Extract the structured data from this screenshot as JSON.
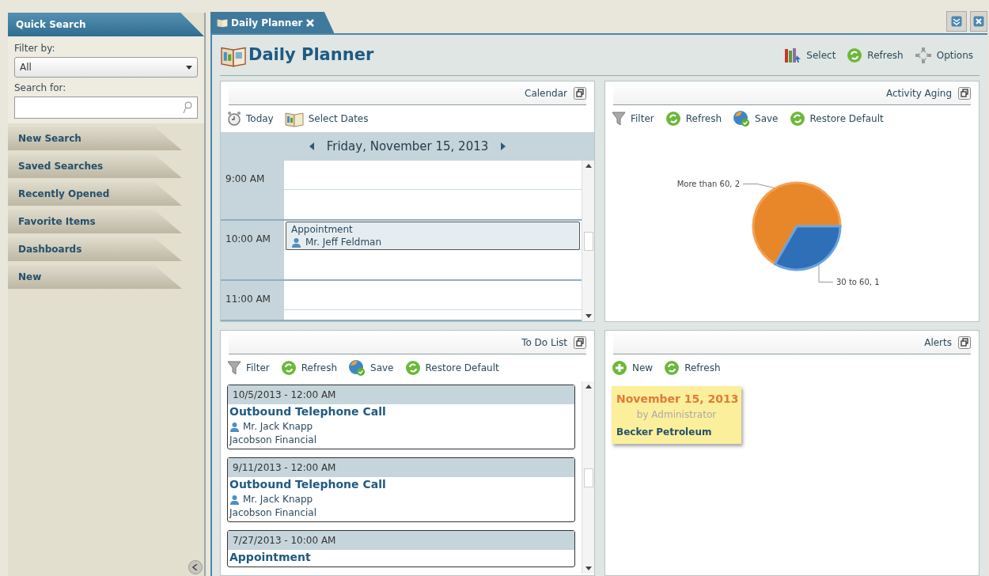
{
  "sidebar": {
    "title": "Quick Search",
    "filter_label": "Filter by:",
    "filter_value": "All",
    "search_label": "Search for:",
    "sections": [
      "New Search",
      "Saved Searches",
      "Recently Opened",
      "Favorite Items",
      "Dashboards",
      "New"
    ]
  },
  "tab": {
    "label": "Daily Planner"
  },
  "header": {
    "title": "Daily Planner",
    "actions": [
      {
        "kind": "select",
        "label": "Select"
      },
      {
        "kind": "refresh",
        "label": "Refresh"
      },
      {
        "kind": "options",
        "label": "Options"
      }
    ]
  },
  "calendar": {
    "title": "Calendar",
    "actions": [
      {
        "kind": "today",
        "label": "Today"
      },
      {
        "kind": "dates",
        "label": "Select Dates"
      }
    ],
    "date": "Friday, November 15, 2013",
    "hours": [
      {
        "time": "9:00 AM"
      },
      {
        "time": "10:00 AM",
        "appointment": {
          "title": "Appointment",
          "person": "Mr. Jeff Feldman"
        }
      },
      {
        "time": "11:00 AM"
      }
    ]
  },
  "activity_aging": {
    "title": "Activity Aging",
    "actions": [
      {
        "kind": "filter",
        "label": "Filter"
      },
      {
        "kind": "refresh",
        "label": "Refresh"
      },
      {
        "kind": "save",
        "label": "Save"
      },
      {
        "kind": "restore",
        "label": "Restore Default"
      }
    ],
    "chart_data": {
      "type": "pie",
      "values": [
        2,
        1
      ],
      "value_labels": [
        "More than 60, 2",
        "30 to 60, 1"
      ]
    }
  },
  "todo": {
    "title": "To Do List",
    "actions": [
      {
        "kind": "filter",
        "label": "Filter"
      },
      {
        "kind": "refresh",
        "label": "Refresh"
      },
      {
        "kind": "save",
        "label": "Save"
      },
      {
        "kind": "restore",
        "label": "Restore Default"
      }
    ],
    "items": [
      {
        "when": "10/5/2013 - 12:00 AM",
        "title": "Outbound Telephone Call",
        "person": "Mr. Jack Knapp",
        "company": "Jacobson Financial"
      },
      {
        "when": "9/11/2013 - 12:00 AM",
        "title": "Outbound Telephone Call",
        "person": "Mr. Jack Knapp",
        "company": "Jacobson Financial"
      },
      {
        "when": "7/27/2013 - 10:00 AM",
        "title": "Appointment"
      }
    ]
  },
  "alerts": {
    "title": "Alerts",
    "actions": [
      {
        "kind": "new",
        "label": "New"
      },
      {
        "kind": "refresh",
        "label": "Refresh"
      }
    ],
    "items": [
      {
        "date": "November 15, 2013",
        "author": "by Administrator",
        "subject": "Becker Petroleum"
      }
    ]
  }
}
